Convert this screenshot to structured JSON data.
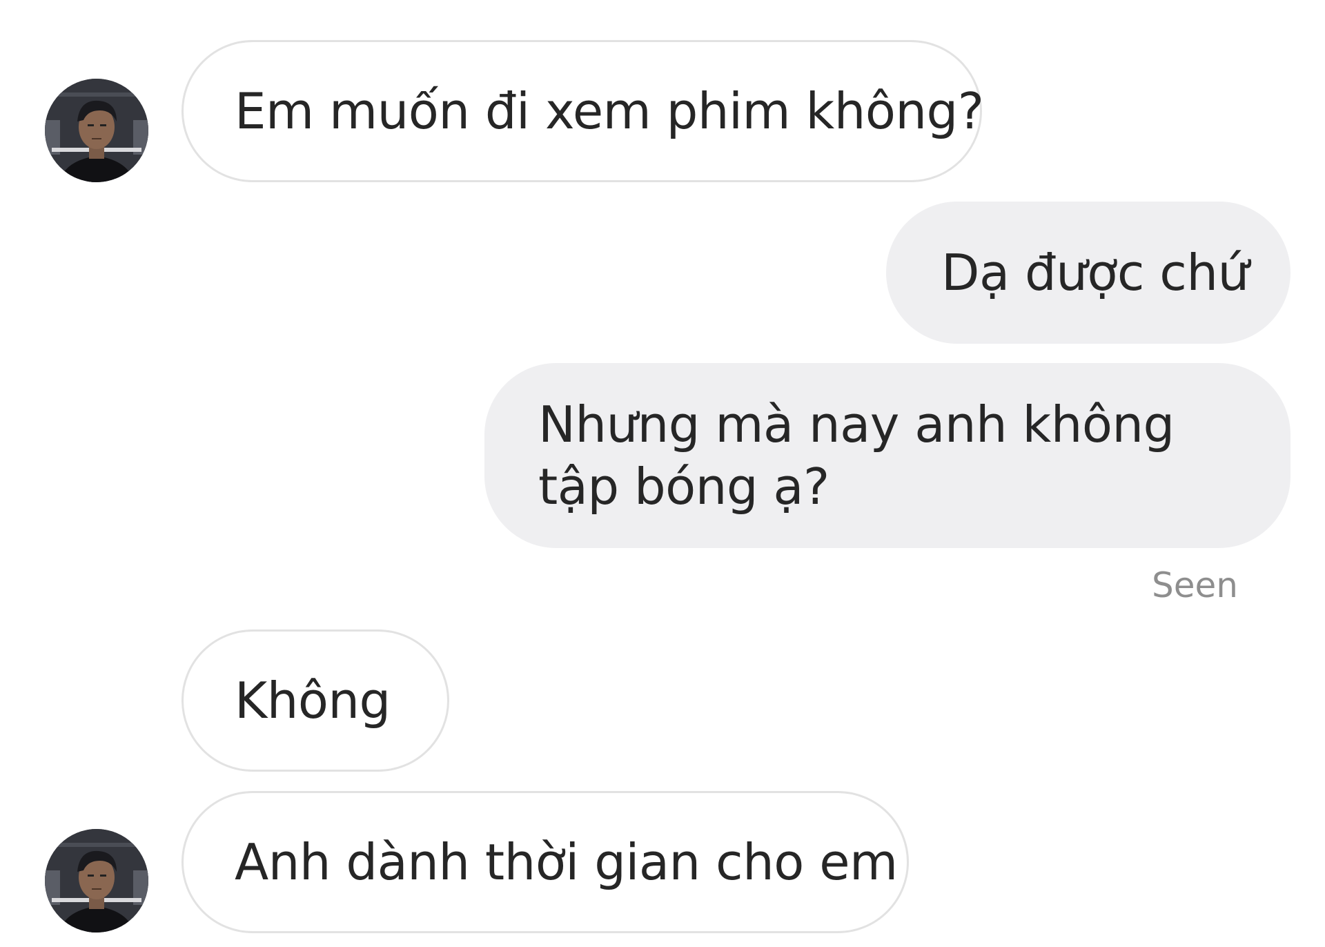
{
  "conversation": {
    "messages": [
      {
        "sender": "other",
        "text": "Em muốn đi xem phim không?"
      },
      {
        "sender": "me",
        "text": "Dạ được chứ"
      },
      {
        "sender": "me",
        "text": "Nhưng mà nay anh không tập bóng ạ?"
      },
      {
        "sender": "other",
        "text": "Không"
      },
      {
        "sender": "other",
        "text": "Anh dành thời gian cho em"
      }
    ],
    "seen_label": "Seen"
  },
  "colors": {
    "incoming_bubble_bg": "#ffffff",
    "incoming_bubble_border": "#e2e2e2",
    "outgoing_bubble_bg": "#efeff1",
    "text": "#262626",
    "seen_text": "#8e8e8e"
  },
  "icons": {
    "avatar": "profile-avatar"
  }
}
